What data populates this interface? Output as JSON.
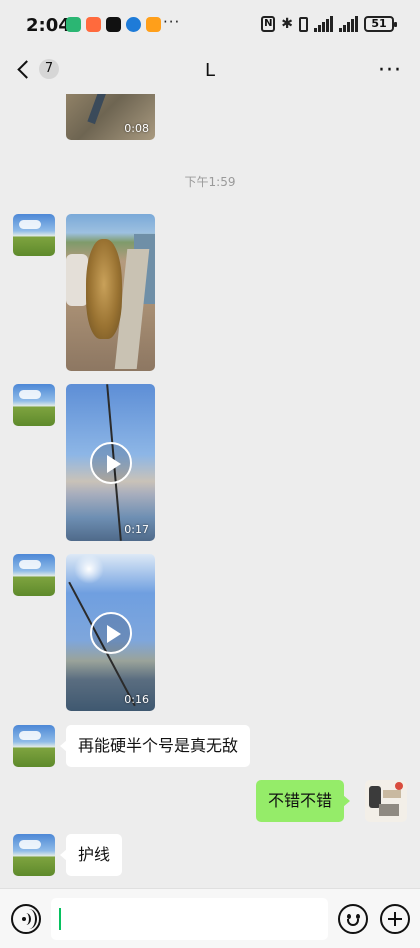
{
  "status_bar": {
    "time": "2:04",
    "app_icons": [
      "#2bb673",
      "#ff6a3d",
      "#111111",
      "#1e7bd8",
      "#ff9f1a"
    ],
    "overflow": "···",
    "nfc": "N",
    "bluetooth": "✱",
    "battery": "51"
  },
  "nav": {
    "unread_count": "7",
    "title": "L",
    "more": "···"
  },
  "messages": {
    "first_video_duration": "0:08",
    "timestamp": "下午1:59",
    "video2_duration": "0:17",
    "video3_duration": "0:16",
    "text1": "再能硬半个号是真无敌",
    "my_text": "不错不错",
    "text2": "护线"
  },
  "input": {
    "value": "",
    "placeholder": ""
  },
  "colors": {
    "background": "#ededed",
    "my_bubble": "#95ec69",
    "accent": "#07c160"
  }
}
